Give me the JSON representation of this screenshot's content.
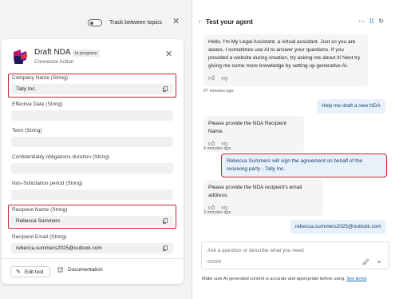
{
  "left": {
    "toggle_label": "Track between topics",
    "card": {
      "title": "Draft NDA",
      "badge": "In progress",
      "subtitle": "Connector Action",
      "fields": [
        {
          "label": "Company Name (String)",
          "value": "Tally Inc.",
          "copy": true
        },
        {
          "label": "Effective Date (String)",
          "value": "",
          "copy": false
        },
        {
          "label": "Term (String)",
          "value": "",
          "copy": false
        },
        {
          "label": "Confidentiality obligations duration (String)",
          "value": "",
          "copy": false
        },
        {
          "label": "Non-Solicitation period (String)",
          "value": "",
          "copy": false
        },
        {
          "label": "Recipient Name (String)",
          "value": "Rebecca Summers",
          "copy": true
        },
        {
          "label": "Recipient Email (String)",
          "value": "rebecca.summers2025@outlook.com",
          "copy": true
        }
      ],
      "edit_tool": "Edit tool",
      "documentation": "Documentation"
    }
  },
  "chat": {
    "title": "Test your agent",
    "messages": {
      "m1": "Hello, I'm My Legal Assistant, a virtual assistant. Just so you are aware, I sometimes use AI to answer your questions. If you provided a website during creation, try asking me about it! Next try giving me some more knowledge by setting up generative AI.",
      "t1": "27 minutes ago",
      "u1": "Help me draft a new NDA",
      "m2": "Please provide the NDA Recipient Name.",
      "t2": "5 minutes ago",
      "u2": "Rebecca Summers will sign the agreement on behalf of the receiving party - Tally Inc.",
      "m3": "Please provide the NDA recipient's email address.",
      "t3": "2 minutes ago",
      "u3": "rebecca.summers2025@outlook.com"
    },
    "input_placeholder": "Ask a question or describe what you need",
    "char_count": "0/2000",
    "disclaimer": "Make sure AI-generated content is accurate and appropriate before using.",
    "see_terms": "See terms"
  },
  "colors": {
    "highlight_red": "#c4262e",
    "user_bubble": "#e8f1fa",
    "link_blue": "#0f6cbd"
  },
  "icons": [
    "toggle-switch",
    "close-icon",
    "copy-icon",
    "thumbs-up-icon",
    "thumbs-down-icon",
    "more-icon",
    "debug-icon",
    "refresh-icon",
    "attach-icon",
    "send-icon",
    "edit-icon",
    "open-link-icon"
  ]
}
